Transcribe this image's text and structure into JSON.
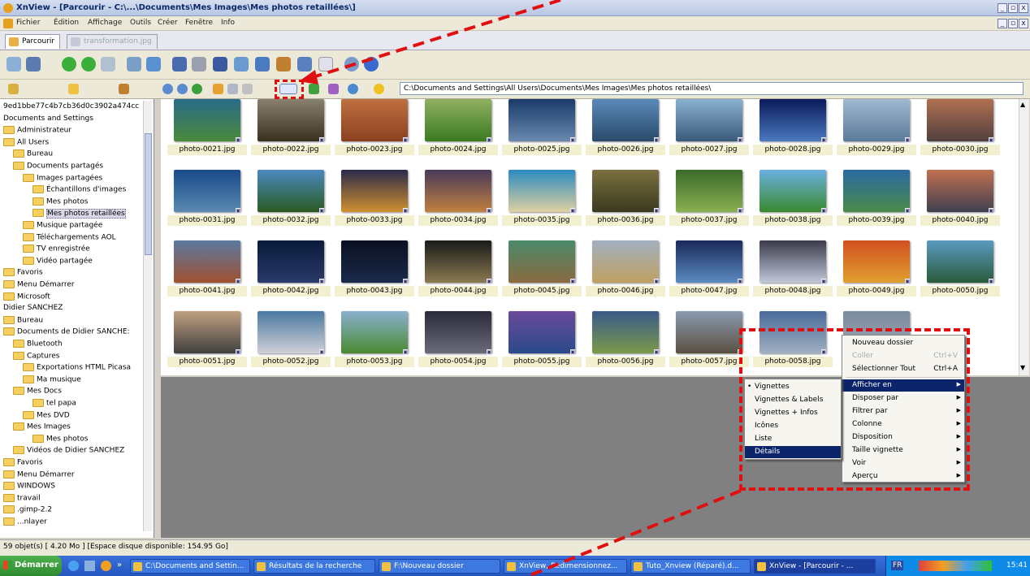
{
  "window": {
    "title": "XnView - [Parcourir - C:\\...\\Documents\\Mes Images\\Mes photos retaillées\\]",
    "controls": [
      "_",
      "▫",
      "x"
    ]
  },
  "menu": [
    "Fichier",
    "Édition",
    "Affichage",
    "Outils",
    "Créer",
    "Fenêtre",
    "Info"
  ],
  "tabs": [
    {
      "label": "Parcourir",
      "active": true
    },
    {
      "label": "transformation.jpg",
      "active": false
    }
  ],
  "path": "C:\\Documents and Settings\\All Users\\Documents\\Mes Images\\Mes photos retaillées\\",
  "tree": [
    {
      "label": "9ed1bbe77c4b7cb36d0c3902a474cc",
      "indent": 0,
      "folder": false
    },
    {
      "label": "Documents and Settings",
      "indent": 0,
      "folder": false
    },
    {
      "label": "Administrateur",
      "indent": 0,
      "folder": true
    },
    {
      "label": "All Users",
      "indent": 0,
      "folder": true
    },
    {
      "label": "Bureau",
      "indent": 1,
      "folder": true
    },
    {
      "label": "Documents partagés",
      "indent": 1,
      "folder": true
    },
    {
      "label": "Images partagées",
      "indent": 2,
      "folder": true
    },
    {
      "label": "Échantillons d'images",
      "indent": 3,
      "folder": true
    },
    {
      "label": "Mes photos",
      "indent": 3,
      "folder": true
    },
    {
      "label": "Mes photos retaillées",
      "indent": 3,
      "folder": true,
      "selected": true
    },
    {
      "label": "Musique partagée",
      "indent": 2,
      "folder": true
    },
    {
      "label": "Téléchargements AOL",
      "indent": 2,
      "folder": true
    },
    {
      "label": "TV enregistrée",
      "indent": 2,
      "folder": true
    },
    {
      "label": "Vidéo partagée",
      "indent": 2,
      "folder": true
    },
    {
      "label": "Favoris",
      "indent": 0,
      "folder": true
    },
    {
      "label": "Menu Démarrer",
      "indent": 0,
      "folder": true
    },
    {
      "label": "Microsoft",
      "indent": 0,
      "folder": true
    },
    {
      "label": "Didier SANCHEZ",
      "indent": 0,
      "folder": false
    },
    {
      "label": "Bureau",
      "indent": 0,
      "folder": true
    },
    {
      "label": "Documents de Didier SANCHE:",
      "indent": 0,
      "folder": true
    },
    {
      "label": "Bluetooth",
      "indent": 1,
      "folder": true
    },
    {
      "label": "Captures",
      "indent": 1,
      "folder": true
    },
    {
      "label": "Exportations HTML Picasa",
      "indent": 2,
      "folder": true
    },
    {
      "label": "Ma musique",
      "indent": 2,
      "folder": true
    },
    {
      "label": "Mes Docs",
      "indent": 1,
      "folder": true
    },
    {
      "label": "tel papa",
      "indent": 3,
      "folder": true
    },
    {
      "label": "Mes DVD",
      "indent": 2,
      "folder": true
    },
    {
      "label": "Mes Images",
      "indent": 1,
      "folder": true
    },
    {
      "label": "Mes photos",
      "indent": 3,
      "folder": true
    },
    {
      "label": "Vidéos de Didier SANCHEZ",
      "indent": 1,
      "folder": true
    },
    {
      "label": "Favoris",
      "indent": 0,
      "folder": true
    },
    {
      "label": "Menu Démarrer",
      "indent": 0,
      "folder": true
    },
    {
      "label": "WINDOWS",
      "indent": 0,
      "folder": true
    },
    {
      "label": "travail",
      "indent": 0,
      "folder": true
    },
    {
      "label": ".gimp-2.2",
      "indent": 0,
      "folder": true
    },
    {
      "label": "...nlayer",
      "indent": 0,
      "folder": true
    }
  ],
  "thumbnails": [
    {
      "name": "photo-0021.jpg",
      "c1": "#2a6b8a",
      "c2": "#4a8a3a"
    },
    {
      "name": "photo-0022.jpg",
      "c1": "#8a8070",
      "c2": "#3a3020"
    },
    {
      "name": "photo-0023.jpg",
      "c1": "#c07040",
      "c2": "#8a4020"
    },
    {
      "name": "photo-0024.jpg",
      "c1": "#90b060",
      "c2": "#3a7a20"
    },
    {
      "name": "photo-0025.jpg",
      "c1": "#1a3a6a",
      "c2": "#6a8ab0"
    },
    {
      "name": "photo-0026.jpg",
      "c1": "#5a8aba",
      "c2": "#2a4a6a"
    },
    {
      "name": "photo-0027.jpg",
      "c1": "#8ab0d0",
      "c2": "#3a5a7a"
    },
    {
      "name": "photo-0028.jpg",
      "c1": "#0a1a5a",
      "c2": "#4a7ac0"
    },
    {
      "name": "photo-0029.jpg",
      "c1": "#a0b8d0",
      "c2": "#5a7a9a"
    },
    {
      "name": "photo-0030.jpg",
      "c1": "#b07050",
      "c2": "#504040"
    },
    {
      "name": "photo-0031.jpg",
      "c1": "#1a4a8a",
      "c2": "#5a8ab0"
    },
    {
      "name": "photo-0032.jpg",
      "c1": "#4a8ac0",
      "c2": "#2a5a20"
    },
    {
      "name": "photo-0033.jpg",
      "c1": "#2a2a4a",
      "c2": "#d09030"
    },
    {
      "name": "photo-0034.jpg",
      "c1": "#4a3a5a",
      "c2": "#c08040"
    },
    {
      "name": "photo-0035.jpg",
      "c1": "#2a8ac0",
      "c2": "#e0d0a0"
    },
    {
      "name": "photo-0036.jpg",
      "c1": "#7a7040",
      "c2": "#3a3a20"
    },
    {
      "name": "photo-0037.jpg",
      "c1": "#3a6a2a",
      "c2": "#8ab050"
    },
    {
      "name": "photo-0038.jpg",
      "c1": "#6ab0e0",
      "c2": "#3a8a30"
    },
    {
      "name": "photo-0039.jpg",
      "c1": "#2a6aa0",
      "c2": "#4a8a4a"
    },
    {
      "name": "photo-0040.jpg",
      "c1": "#c07050",
      "c2": "#404050"
    },
    {
      "name": "photo-0041.jpg",
      "c1": "#5a7aa0",
      "c2": "#a05030"
    },
    {
      "name": "photo-0042.jpg",
      "c1": "#0a1a3a",
      "c2": "#2a3a6a"
    },
    {
      "name": "photo-0043.jpg",
      "c1": "#0a1020",
      "c2": "#1a2a4a"
    },
    {
      "name": "photo-0044.jpg",
      "c1": "#1a1a1a",
      "c2": "#8a7a50"
    },
    {
      "name": "photo-0045.jpg",
      "c1": "#4a8a6a",
      "c2": "#8a6a40"
    },
    {
      "name": "photo-0046.jpg",
      "c1": "#a0b0c0",
      "c2": "#c0a060"
    },
    {
      "name": "photo-0047.jpg",
      "c1": "#1a2a5a",
      "c2": "#5a8ac0"
    },
    {
      "name": "photo-0048.jpg",
      "c1": "#3a3a4a",
      "c2": "#c0c8d8"
    },
    {
      "name": "photo-0049.jpg",
      "c1": "#d05020",
      "c2": "#e0a030"
    },
    {
      "name": "photo-0050.jpg",
      "c1": "#5a9ac0",
      "c2": "#2a5a3a"
    },
    {
      "name": "photo-0051.jpg",
      "c1": "#c0a080",
      "c2": "#404040"
    },
    {
      "name": "photo-0052.jpg",
      "c1": "#4a7aa0",
      "c2": "#d0d0d8"
    },
    {
      "name": "photo-0053.jpg",
      "c1": "#8ab0d0",
      "c2": "#4a8a30"
    },
    {
      "name": "photo-0054.jpg",
      "c1": "#2a2a3a",
      "c2": "#6a6a7a"
    },
    {
      "name": "photo-0055.jpg",
      "c1": "#6a4a9a",
      "c2": "#2a4a8a"
    },
    {
      "name": "photo-0056.jpg",
      "c1": "#3a5a8a",
      "c2": "#7a9a4a"
    },
    {
      "name": "photo-0057.jpg",
      "c1": "#8a9ab0",
      "c2": "#5a5040"
    },
    {
      "name": "photo-0058.jpg",
      "c1": "#4a6a9a",
      "c2": "#a0b0c0"
    },
    {
      "name": "",
      "c1": "#7a8aa0",
      "c2": "#a0a8b0"
    }
  ],
  "status": "59 objet(s) [ 4.20 Mo ] [Espace disque disponible: 154.95 Go]",
  "context_menu": {
    "items": [
      {
        "label": "Nouveau dossier",
        "shortcut": "",
        "disabled": false,
        "arrow": false
      },
      {
        "label": "Coller",
        "shortcut": "Ctrl+V",
        "disabled": true,
        "arrow": false
      },
      {
        "label": "Sélectionner Tout",
        "shortcut": "Ctrl+A",
        "disabled": false,
        "arrow": false
      },
      {
        "label": "Afficher en",
        "shortcut": "",
        "disabled": false,
        "arrow": true,
        "highlight": true
      },
      {
        "label": "Disposer par",
        "shortcut": "",
        "disabled": false,
        "arrow": true
      },
      {
        "label": "Filtrer par",
        "shortcut": "",
        "disabled": false,
        "arrow": true
      },
      {
        "label": "Colonne",
        "shortcut": "",
        "disabled": false,
        "arrow": true
      },
      {
        "label": "Disposition",
        "shortcut": "",
        "disabled": false,
        "arrow": true
      },
      {
        "label": "Taille vignette",
        "shortcut": "",
        "disabled": false,
        "arrow": true
      },
      {
        "label": "Voir",
        "shortcut": "",
        "disabled": false,
        "arrow": true
      },
      {
        "label": "Aperçu",
        "shortcut": "",
        "disabled": false,
        "arrow": true
      }
    ]
  },
  "submenu": {
    "items": [
      {
        "label": "Vignettes",
        "checked": true
      },
      {
        "label": "Vignettes & Labels",
        "checked": false
      },
      {
        "label": "Vignettes + Infos",
        "checked": false
      },
      {
        "label": "Icônes",
        "checked": false
      },
      {
        "label": "Liste",
        "checked": false
      },
      {
        "label": "Détails",
        "checked": false,
        "highlight": true
      }
    ]
  },
  "taskbar": {
    "start": "Démarrer",
    "buttons": [
      {
        "label": "C:\\Documents and Settin...",
        "active": false
      },
      {
        "label": "Résultats de la recherche",
        "active": false
      },
      {
        "label": "F:\\Nouveau dossier",
        "active": false
      },
      {
        "label": "XnView, Redimensionnez...",
        "active": false
      },
      {
        "label": "Tuto_Xnview (Réparé).d...",
        "active": false
      },
      {
        "label": "XnView - [Parcourir - ...",
        "active": true
      }
    ],
    "lang": "FR",
    "clock": "15:41"
  },
  "colors": {
    "annotation": "#e01010",
    "selection": "#0b246a"
  }
}
